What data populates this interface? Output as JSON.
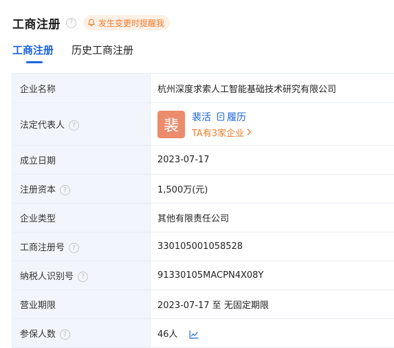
{
  "header": {
    "title": "工商注册",
    "notify_label": "发生变更时提醒我"
  },
  "tabs": [
    {
      "label": "工商注册"
    },
    {
      "label": "历史工商注册"
    }
  ],
  "rows": {
    "company_name": {
      "label": "企业名称",
      "value": "杭州深度求索人工智能基础技术研究有限公司"
    },
    "legal_rep": {
      "label": "法定代表人",
      "avatar_char": "裴",
      "name": "裴活",
      "resume_label": "履历",
      "companies_label": "TA有3家企业"
    },
    "founded": {
      "label": "成立日期",
      "value": "2023-07-17"
    },
    "capital": {
      "label": "注册资本",
      "value": "1,500万(元)"
    },
    "type": {
      "label": "企业类型",
      "value": "其他有限责任公司"
    },
    "reg_no": {
      "label": "工商注册号",
      "value": "330105001058528"
    },
    "tax_id": {
      "label": "纳税人识别号",
      "value": "91330105MACPN4X08Y"
    },
    "term": {
      "label": "营业期限",
      "value": "2023-07-17 至 无固定期限"
    },
    "insured": {
      "label": "参保人数",
      "value": "46人"
    }
  },
  "colors": {
    "accent": "#1b63e0",
    "warning": "#ee7b2a",
    "avatar_bg": "#ec8c6c",
    "label_bg": "#f2f6fc"
  },
  "icons": [
    "question-circle-icon",
    "bell-icon",
    "document-icon",
    "chevron-right-icon",
    "trend-chart-icon"
  ]
}
